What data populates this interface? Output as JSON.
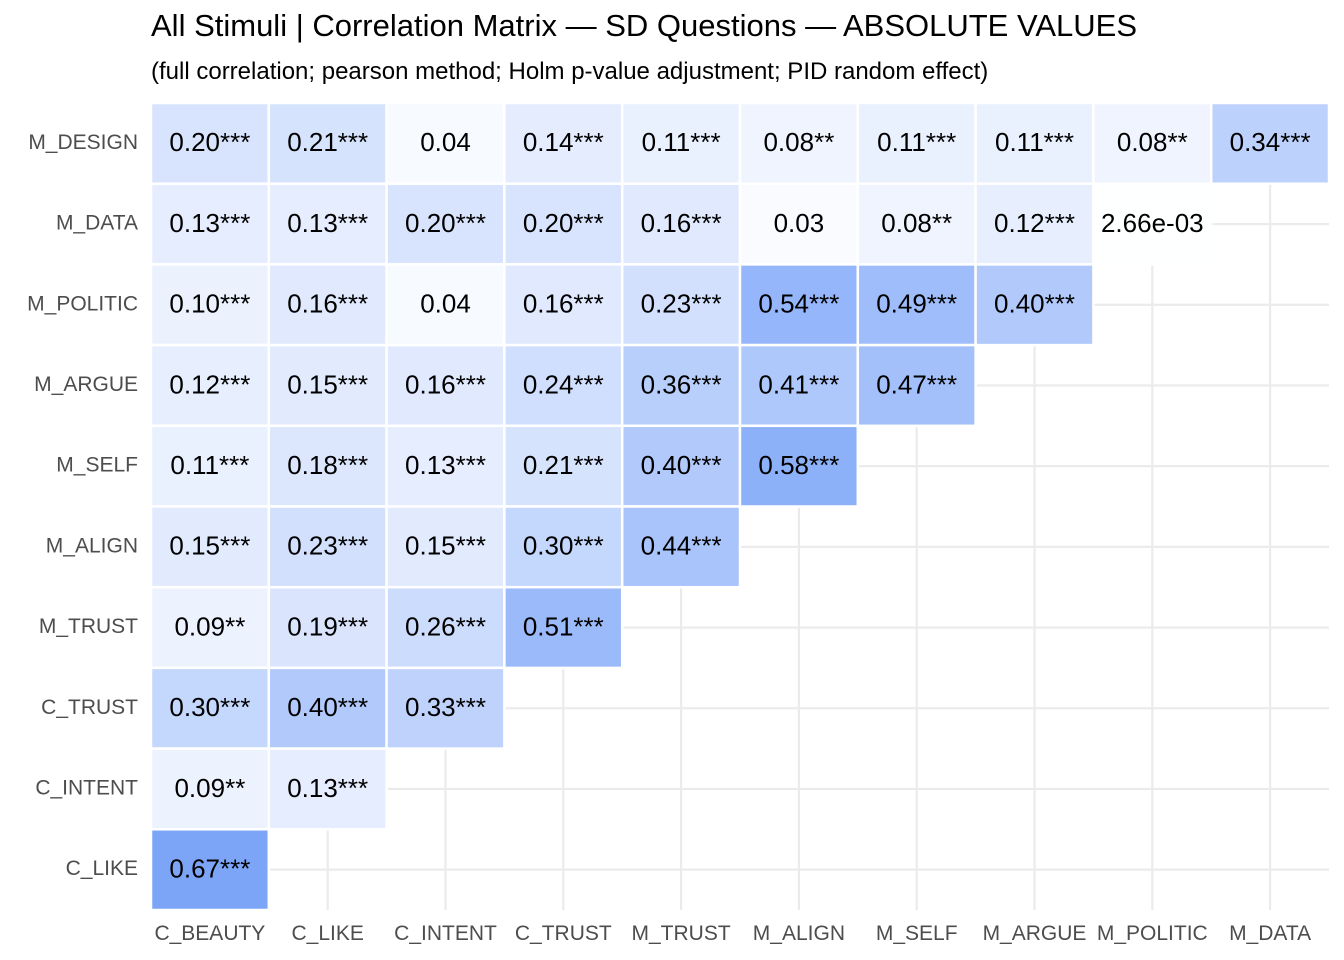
{
  "chart_data": {
    "type": "heatmap",
    "title": "All Stimuli | Correlation Matrix — SD Questions — ABSOLUTE VALUES",
    "subtitle": "(full correlation; pearson method; Holm p-value adjustment; PID random effect)",
    "x_categories": [
      "C_BEAUTY",
      "C_LIKE",
      "C_INTENT",
      "C_TRUST",
      "M_TRUST",
      "M_ALIGN",
      "M_SELF",
      "M_ARGUE",
      "M_POLITIC",
      "M_DATA"
    ],
    "y_categories": [
      "M_DESIGN",
      "M_DATA",
      "M_POLITIC",
      "M_ARGUE",
      "M_SELF",
      "M_ALIGN",
      "M_TRUST",
      "C_TRUST",
      "C_INTENT",
      "C_LIKE"
    ],
    "values": [
      [
        0.2,
        0.21,
        0.04,
        0.14,
        0.11,
        0.08,
        0.11,
        0.11,
        0.08,
        0.34
      ],
      [
        0.13,
        0.13,
        0.2,
        0.2,
        0.16,
        0.03,
        0.08,
        0.12,
        0.00266
      ],
      [
        0.1,
        0.16,
        0.04,
        0.16,
        0.23,
        0.54,
        0.49,
        0.4
      ],
      [
        0.12,
        0.15,
        0.16,
        0.24,
        0.36,
        0.41,
        0.47
      ],
      [
        0.11,
        0.18,
        0.13,
        0.21,
        0.4,
        0.58
      ],
      [
        0.15,
        0.23,
        0.15,
        0.3,
        0.44
      ],
      [
        0.09,
        0.19,
        0.26,
        0.51
      ],
      [
        0.3,
        0.4,
        0.33
      ],
      [
        0.09,
        0.13
      ],
      [
        0.67
      ]
    ],
    "labels": [
      [
        "0.20***",
        "0.21***",
        "0.04",
        "0.14***",
        "0.11***",
        "0.08**",
        "0.11***",
        "0.11***",
        "0.08**",
        "0.34***"
      ],
      [
        "0.13***",
        "0.13***",
        "0.20***",
        "0.20***",
        "0.16***",
        "0.03",
        "0.08**",
        "0.12***",
        "2.66e-03"
      ],
      [
        "0.10***",
        "0.16***",
        "0.04",
        "0.16***",
        "0.23***",
        "0.54***",
        "0.49***",
        "0.40***"
      ],
      [
        "0.12***",
        "0.15***",
        "0.16***",
        "0.24***",
        "0.36***",
        "0.41***",
        "0.47***"
      ],
      [
        "0.11***",
        "0.18***",
        "0.13***",
        "0.21***",
        "0.40***",
        "0.58***"
      ],
      [
        "0.15***",
        "0.23***",
        "0.15***",
        "0.30***",
        "0.44***"
      ],
      [
        "0.09**",
        "0.19***",
        "0.26***",
        "0.51***"
      ],
      [
        "0.30***",
        "0.40***",
        "0.33***"
      ],
      [
        "0.09**",
        "0.13***"
      ],
      [
        "0.67***"
      ]
    ],
    "color_low": "#ffffff",
    "color_high": "#3b78f5",
    "value_range": [
      0,
      1
    ],
    "grid": true,
    "legend": "none"
  }
}
